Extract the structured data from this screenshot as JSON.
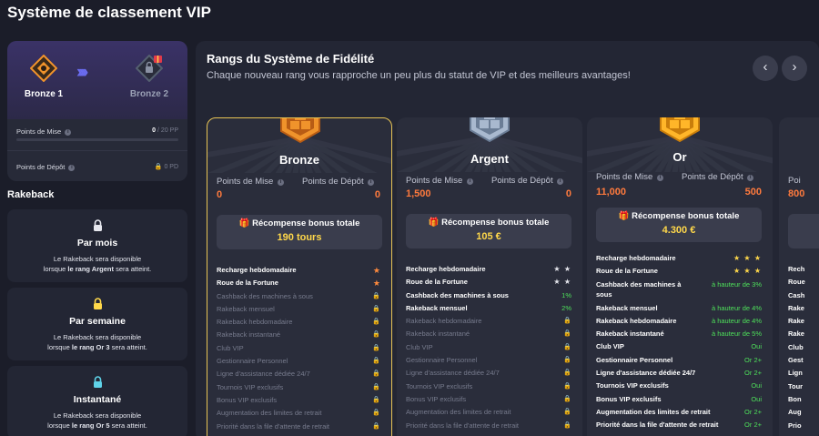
{
  "page": {
    "title": "Système de classement VIP"
  },
  "progress": {
    "current_rank": "Bronze 1",
    "next_rank": "Bronze 2",
    "wager": {
      "label": "Points de Mise",
      "value": "0",
      "target": "/ 20 PP",
      "fraction": 0
    },
    "deposit": {
      "label": "Points de Dépôt",
      "value": "0 PD"
    }
  },
  "rakeback": {
    "title": "Rakeback",
    "items": [
      {
        "title": "Par mois",
        "line1": "Le Rakeback sera disponible",
        "line2_pre": "lorsque ",
        "line2_bold": "le rang Argent",
        "line2_post": " sera atteint.",
        "lock_color": "#e6e7ee"
      },
      {
        "title": "Par semaine",
        "line1": "Le Rakeback sera disponible",
        "line2_pre": "lorsque ",
        "line2_bold": "le rang Or 3",
        "line2_post": " sera atteint.",
        "lock_color": "#ffd84a"
      },
      {
        "title": "Instantané",
        "line1": "Le Rakeback sera disponible",
        "line2_pre": "lorsque ",
        "line2_bold": "le rang Or 5",
        "line2_post": " sera atteint.",
        "lock_color": "#5fd3e8"
      }
    ]
  },
  "panel": {
    "title": "Rangs du Système de Fidélité",
    "subtitle": "Chaque nouveau rang vous rapproche un peu plus du statut de VIP et des meilleurs avantages!",
    "prev_icon": "‹",
    "next_icon": "›"
  },
  "labels": {
    "wager": "Points de Mise",
    "deposit": "Points de Dépôt",
    "reward": "Récompense bonus totale",
    "lock": "🔒",
    "gift": "🎁",
    "star": "★"
  },
  "tiers": [
    {
      "name": "Bronze",
      "wager": "0",
      "deposit": "0",
      "reward": "190 tours",
      "colors": {
        "gem": "#f0932b",
        "gem_dark": "#b85c14",
        "ray": "#3a3d4d"
      },
      "perks": [
        {
          "name": "Recharge hebdomadaire",
          "on": true,
          "value": "★",
          "kind": "star"
        },
        {
          "name": "Roue de la Fortune",
          "on": true,
          "value": "★",
          "kind": "star"
        },
        {
          "name": "Cashback des machines à sous",
          "on": false,
          "value": "🔒",
          "kind": "lock"
        },
        {
          "name": "Rakeback mensuel",
          "on": false,
          "value": "🔒",
          "kind": "lock"
        },
        {
          "name": "Rakeback hebdomadaire",
          "on": false,
          "value": "🔒",
          "kind": "lock"
        },
        {
          "name": "Rakeback instantané",
          "on": false,
          "value": "🔒",
          "kind": "lock"
        },
        {
          "name": "Club VIP",
          "on": false,
          "value": "🔒",
          "kind": "lock"
        },
        {
          "name": "Gestionnaire Personnel",
          "on": false,
          "value": "🔒",
          "kind": "lock"
        },
        {
          "name": "Ligne d'assistance dédiée 24/7",
          "on": false,
          "value": "🔒",
          "kind": "lock"
        },
        {
          "name": "Tournois VIP exclusifs",
          "on": false,
          "value": "🔒",
          "kind": "lock"
        },
        {
          "name": "Bonus VIP exclusifs",
          "on": false,
          "value": "🔒",
          "kind": "lock"
        },
        {
          "name": "Augmentation des limites de retrait",
          "on": false,
          "value": "🔒",
          "kind": "lock"
        },
        {
          "name": "Priorité dans la file d'attente de retrait",
          "on": false,
          "value": "🔒",
          "kind": "lock"
        }
      ]
    },
    {
      "name": "Argent",
      "wager": "1,500",
      "deposit": "0",
      "reward": "105 €",
      "colors": {
        "gem": "#a9b9cf",
        "gem_dark": "#6b7d96",
        "ray": "#3a3d4d"
      },
      "perks": [
        {
          "name": "Recharge hebdomadaire",
          "on": true,
          "value": "★ ★",
          "kind": "wstar"
        },
        {
          "name": "Roue de la Fortune",
          "on": true,
          "value": "★ ★",
          "kind": "wstar"
        },
        {
          "name": "Cashback des machines à sous",
          "on": true,
          "value": "1%",
          "kind": "green"
        },
        {
          "name": "Rakeback mensuel",
          "on": true,
          "value": "2%",
          "kind": "green"
        },
        {
          "name": "Rakeback hebdomadaire",
          "on": false,
          "value": "🔒",
          "kind": "lock"
        },
        {
          "name": "Rakeback instantané",
          "on": false,
          "value": "🔒",
          "kind": "lock"
        },
        {
          "name": "Club VIP",
          "on": false,
          "value": "🔒",
          "kind": "lock"
        },
        {
          "name": "Gestionnaire Personnel",
          "on": false,
          "value": "🔒",
          "kind": "lock"
        },
        {
          "name": "Ligne d'assistance dédiée 24/7",
          "on": false,
          "value": "🔒",
          "kind": "lock"
        },
        {
          "name": "Tournois VIP exclusifs",
          "on": false,
          "value": "🔒",
          "kind": "lock"
        },
        {
          "name": "Bonus VIP exclusifs",
          "on": false,
          "value": "🔒",
          "kind": "lock"
        },
        {
          "name": "Augmentation des limites de retrait",
          "on": false,
          "value": "🔒",
          "kind": "lock"
        },
        {
          "name": "Priorité dans la file d'attente de retrait",
          "on": false,
          "value": "🔒",
          "kind": "lock"
        }
      ]
    },
    {
      "name": "Or",
      "wager": "11,000",
      "deposit": "500",
      "reward": "4.300 €",
      "colors": {
        "gem": "#ffb629",
        "gem_dark": "#c97d0a",
        "ray": "#3a3d4d"
      },
      "perks": [
        {
          "name": "Recharge hebdomadaire",
          "on": true,
          "value": "★ ★ ★",
          "kind": "ystar"
        },
        {
          "name": "Roue de la Fortune",
          "on": true,
          "value": "★ ★ ★",
          "kind": "ystar"
        },
        {
          "name": "Cashback des machines à sous",
          "on": true,
          "value": "à hauteur de 3%",
          "kind": "green",
          "tall": true
        },
        {
          "name": "Rakeback mensuel",
          "on": true,
          "value": "à hauteur de 4%",
          "kind": "green"
        },
        {
          "name": "Rakeback hebdomadaire",
          "on": true,
          "value": "à hauteur de 4%",
          "kind": "green"
        },
        {
          "name": "Rakeback instantané",
          "on": true,
          "value": "à hauteur de 5%",
          "kind": "green"
        },
        {
          "name": "Club VIP",
          "on": true,
          "value": "Oui",
          "kind": "green"
        },
        {
          "name": "Gestionnaire Personnel",
          "on": true,
          "value": "Or 2+",
          "kind": "green"
        },
        {
          "name": "Ligne d'assistance dédiée 24/7",
          "on": true,
          "value": "Or 2+",
          "kind": "green"
        },
        {
          "name": "Tournois VIP exclusifs",
          "on": true,
          "value": "Oui",
          "kind": "green"
        },
        {
          "name": "Bonus VIP exclusifs",
          "on": true,
          "value": "Oui",
          "kind": "green"
        },
        {
          "name": "Augmentation des limites de retrait",
          "on": true,
          "value": "Or 2+",
          "kind": "green"
        },
        {
          "name": "Priorité dans la file d'attente de retrait",
          "on": true,
          "value": "Or 2+",
          "kind": "green"
        }
      ]
    }
  ],
  "partial_tier": {
    "wager_label": "Poi",
    "wager": "800",
    "perks": [
      "Rech",
      "Roue",
      "Cash",
      "Rake",
      "Rake",
      "Rake",
      "Club",
      "Gest",
      "Lign",
      "Tour",
      "Bon",
      "Aug",
      "Prio"
    ]
  }
}
